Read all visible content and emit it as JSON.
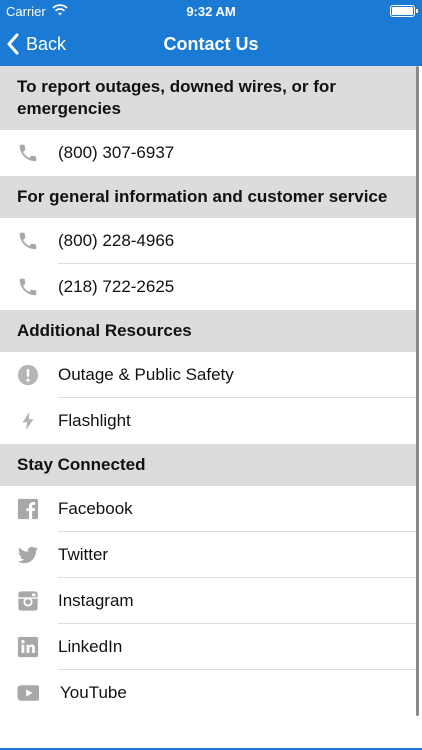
{
  "status_bar": {
    "carrier": "Carrier",
    "time": "9:32 AM"
  },
  "nav": {
    "back_label": "Back",
    "title": "Contact Us"
  },
  "sections": [
    {
      "header": "To report outages, downed wires, or for emergencies",
      "rows": [
        {
          "icon": "phone-icon",
          "label": "(800) 307-6937"
        }
      ]
    },
    {
      "header": "For general information and customer service",
      "rows": [
        {
          "icon": "phone-icon",
          "label": "(800) 228-4966"
        },
        {
          "icon": "phone-icon",
          "label": "(218) 722-2625"
        }
      ]
    },
    {
      "header": "Additional Resources",
      "rows": [
        {
          "icon": "alert-icon",
          "label": "Outage & Public Safety"
        },
        {
          "icon": "lightning-icon",
          "label": "Flashlight"
        }
      ]
    },
    {
      "header": "Stay Connected",
      "rows": [
        {
          "icon": "facebook-icon",
          "label": "Facebook"
        },
        {
          "icon": "twitter-icon",
          "label": "Twitter"
        },
        {
          "icon": "instagram-icon",
          "label": "Instagram"
        },
        {
          "icon": "linkedin-icon",
          "label": "LinkedIn"
        },
        {
          "icon": "youtube-icon",
          "label": "YouTube"
        }
      ]
    }
  ],
  "colors": {
    "brand": "#1a7ad4",
    "section_bg": "#dcdcdc",
    "icon": "#a8a8a8"
  }
}
